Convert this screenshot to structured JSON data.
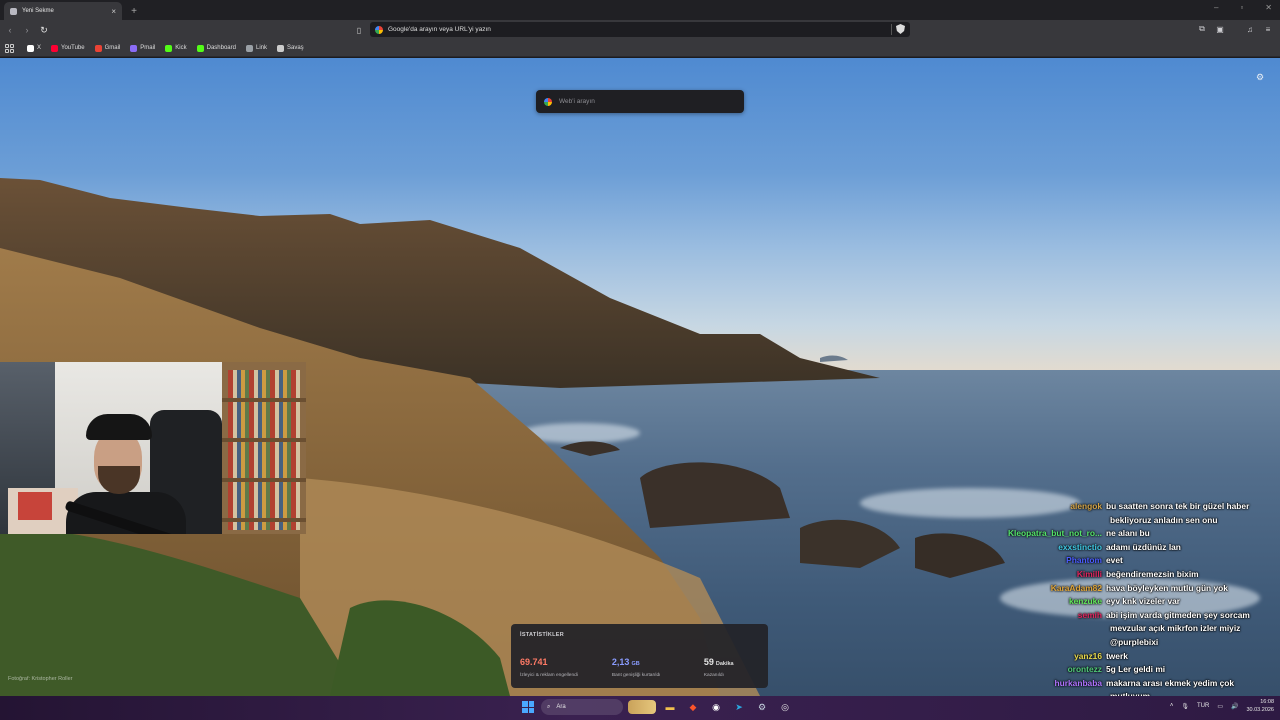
{
  "browser": {
    "tab_title": "Yeni Sekme",
    "tab_close": "×",
    "new_tab": "+",
    "window_controls": [
      "–",
      "▫",
      "✕"
    ],
    "address_bar": "Google'da arayın veya URL'yi yazın"
  },
  "bookmarks": [
    {
      "label": "X",
      "icon": "x-icon",
      "color": "#ffffff"
    },
    {
      "label": "YouTube",
      "icon": "youtube-icon",
      "color": "#ff0033"
    },
    {
      "label": "Gmail",
      "icon": "gmail-icon",
      "color": "#ea4335"
    },
    {
      "label": "Pmail",
      "icon": "proton-mail-icon",
      "color": "#8b6cf6"
    },
    {
      "label": "Kick",
      "icon": "kick-icon",
      "color": "#53fc18"
    },
    {
      "label": "Dashboard",
      "icon": "kick-icon",
      "color": "#53fc18"
    },
    {
      "label": "Link",
      "icon": "link-icon",
      "color": "#9aa0a6"
    },
    {
      "label": "Savaş",
      "icon": "folder-icon",
      "color": "#cccccc"
    }
  ],
  "newtab": {
    "search_placeholder": "Web'i arayın",
    "photo_credit": "Fotoğraf: Kristopher Roller"
  },
  "stats": {
    "title": "İSTATİSTİKLER",
    "items": [
      {
        "value": "69.741",
        "unit": "",
        "label": "İzleyici & reklam engellendi",
        "color": "#ff7a66"
      },
      {
        "value": "2,13",
        "unit": "GB",
        "label": "Bant genişliği kurtarıldı",
        "color": "#8a9cff"
      },
      {
        "value": "59",
        "unit": "Dakika",
        "label": "Kazanıldı",
        "color": "#ffffff"
      }
    ]
  },
  "chat": [
    {
      "user": "alengok",
      "color": "#d2a347",
      "text": "bu saatten sonra tek bir güzel haber",
      "cont": "bekliyoruz anladın sen onu"
    },
    {
      "user": "Kleopatra_but_not_ro...",
      "color": "#54e36a",
      "text": "ne alanı bu"
    },
    {
      "user": "exxstinctio",
      "color": "#3ec6e0",
      "text": "adamı üzdünüz lan"
    },
    {
      "user": "Phantom",
      "color": "#4a5cff",
      "text": "evet"
    },
    {
      "user": "Kimilli",
      "color": "#e0245e",
      "text": "beğendiremezsin bixim"
    },
    {
      "user": "KaraAdam82",
      "color": "#e0a63a",
      "text": "hava böyleyken mutlu gün yok"
    },
    {
      "user": "kenzuke",
      "color": "#62e85a",
      "text": "eyv knk vizeler var"
    },
    {
      "user": "semih",
      "color": "#e0245e",
      "text": "abi işim varda gitmeden şey sorcam",
      "cont": "mevzular açık mikrfon izler miyiz",
      "cont2": "@purplebixi"
    },
    {
      "user": "yanz16",
      "color": "#e8d84a",
      "text": "twerk"
    },
    {
      "user": "orontezz",
      "color": "#50c878",
      "text": "5g Ler geldi mi"
    },
    {
      "user": "hurkanbaba",
      "color": "#b073ff",
      "text": "makarna arası ekmek yedim çok",
      "cont": "mutluyum"
    }
  ],
  "taskbar": {
    "search_label": "Ara",
    "lang": "TUR",
    "time": "16:08",
    "date": "30.03.2026"
  }
}
